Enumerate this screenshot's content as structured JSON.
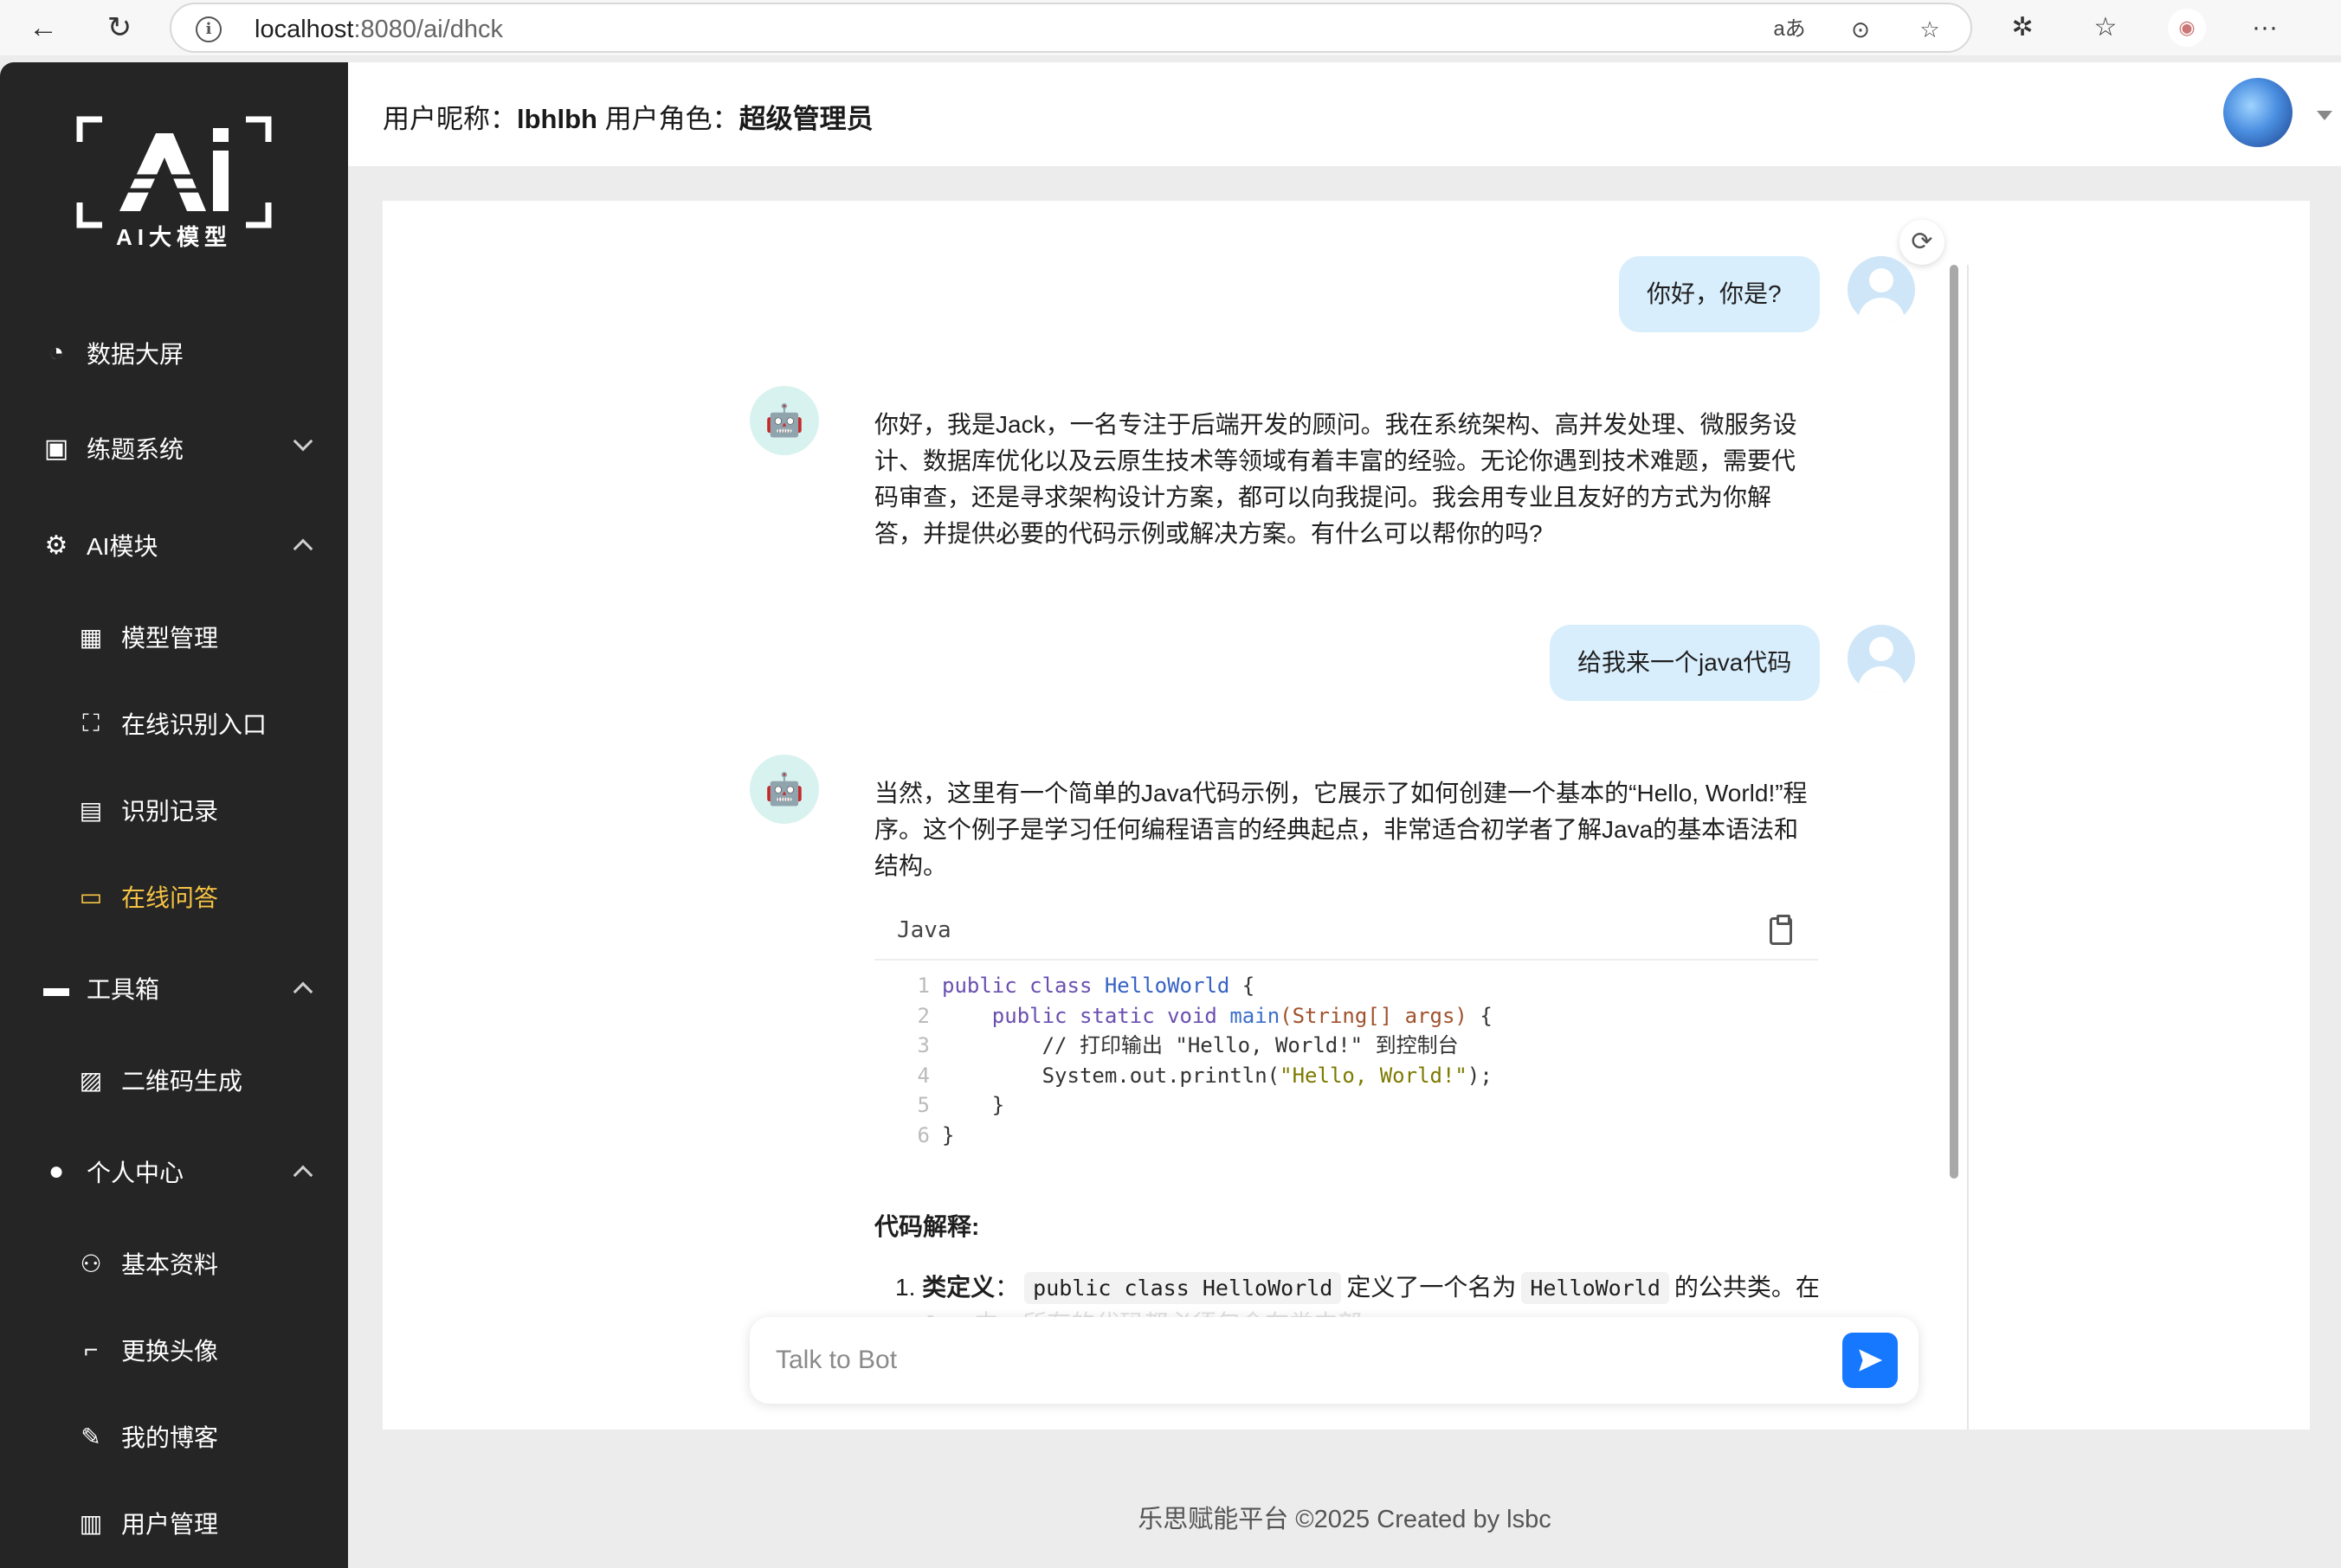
{
  "browser": {
    "url_host": "localhost",
    "url_path": ":8080/ai/dhck",
    "translate_icon": "aあ"
  },
  "sidebar": {
    "logo_text": "AI大模型",
    "items": [
      {
        "label": "数据大屏",
        "icon": "dashboard-icon"
      },
      {
        "label": "练题系统",
        "icon": "book-icon"
      },
      {
        "label": "AI模块",
        "icon": "chip-icon"
      },
      {
        "label": "工具箱",
        "icon": "toolbox-icon"
      },
      {
        "label": "个人中心",
        "icon": "user-icon"
      }
    ],
    "subitems": [
      {
        "label": "模型管理",
        "icon": "grid-icon"
      },
      {
        "label": "在线识别入口",
        "icon": "scan-icon"
      },
      {
        "label": "识别记录",
        "icon": "clipboard-icon"
      },
      {
        "label": "在线问答",
        "icon": "chat-icon",
        "active": true
      },
      {
        "label": "二维码生成",
        "icon": "image-icon"
      },
      {
        "label": "基本资料",
        "icon": "person-icon"
      },
      {
        "label": "更换头像",
        "icon": "crop-icon"
      },
      {
        "label": "我的博客",
        "icon": "edit-icon"
      },
      {
        "label": "用户管理",
        "icon": "library-icon"
      }
    ]
  },
  "header": {
    "nickname_label": "用户昵称：",
    "nickname": "lbhlbh",
    "role_label": " 用户角色：",
    "role": "超级管理员"
  },
  "chat": {
    "messages": [
      {
        "from": "user",
        "text": "你好，你是?"
      },
      {
        "from": "bot",
        "lines": [
          "你好，我是Jack，一名专注于后端开发的顾问。我在系统架构、高并发处理、微服务设",
          "计、数据库优化以及云原生技术等领域有着丰富的经验。无论你遇到技术难题，需要代",
          "码审查，还是寻求架构设计方案，都可以向我提问。我会用专业且友好的方式为你解",
          "答，并提供必要的代码示例或解决方案。有什么可以帮你的吗?"
        ]
      },
      {
        "from": "user",
        "text": "给我来一个java代码"
      },
      {
        "from": "bot",
        "lines": [
          "当然，这里有一个简单的Java代码示例，它展示了如何创建一个基本的“Hello, World!”程",
          "序。这个例子是学习任何编程语言的经典起点，非常适合初学者了解Java的基本语法和",
          "结构。"
        ]
      }
    ],
    "code": {
      "language": "Java",
      "line_numbers": [
        "1",
        "2",
        "3",
        "4",
        "5",
        "6"
      ]
    },
    "explain_title": "代码解释:",
    "explain_item_prefix": "1. ",
    "explain_item_term": "类定义",
    "explain_item_colon": "：",
    "explain_item_code1": "public class HelloWorld",
    "explain_item_mid": "定义了一个名为",
    "explain_item_code2": "HelloWorld",
    "explain_item_end": "的公共类。在",
    "explain_fade": "Java中，所有的代码都必须包含在类内部。",
    "input_placeholder": "Talk to Bot"
  },
  "footer": {
    "text": "乐思赋能平台 ©2025 Created by lsbc"
  },
  "colors": {
    "sidebar_bg": "#252525",
    "active": "#f6c344",
    "user_bubble": "#d8eefc",
    "send": "#1677ff"
  }
}
